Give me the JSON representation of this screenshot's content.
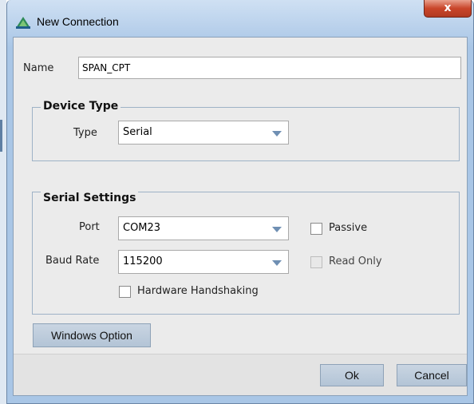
{
  "window": {
    "title": "New Connection",
    "close_label": "x"
  },
  "name_field": {
    "label": "Name",
    "value": "SPAN_CPT"
  },
  "device_type": {
    "group_title": "Device Type",
    "type_label": "Type",
    "type_value": "Serial"
  },
  "serial_settings": {
    "group_title": "Serial Settings",
    "port_label": "Port",
    "port_value": "COM23",
    "baud_label": "Baud Rate",
    "baud_value": "115200",
    "passive_label": "Passive",
    "passive_checked": false,
    "read_only_label": "Read Only",
    "read_only_checked": false,
    "read_only_enabled": false,
    "hw_handshaking_label": "Hardware Handshaking",
    "hw_handshaking_checked": false
  },
  "buttons": {
    "windows_option": "Windows Option",
    "ok": "Ok",
    "cancel": "Cancel"
  },
  "colors": {
    "title_bar": "#a9c6e6",
    "close_button": "#c9452a",
    "button": "#b9c9da",
    "dialog_background": "#ebebeb"
  }
}
